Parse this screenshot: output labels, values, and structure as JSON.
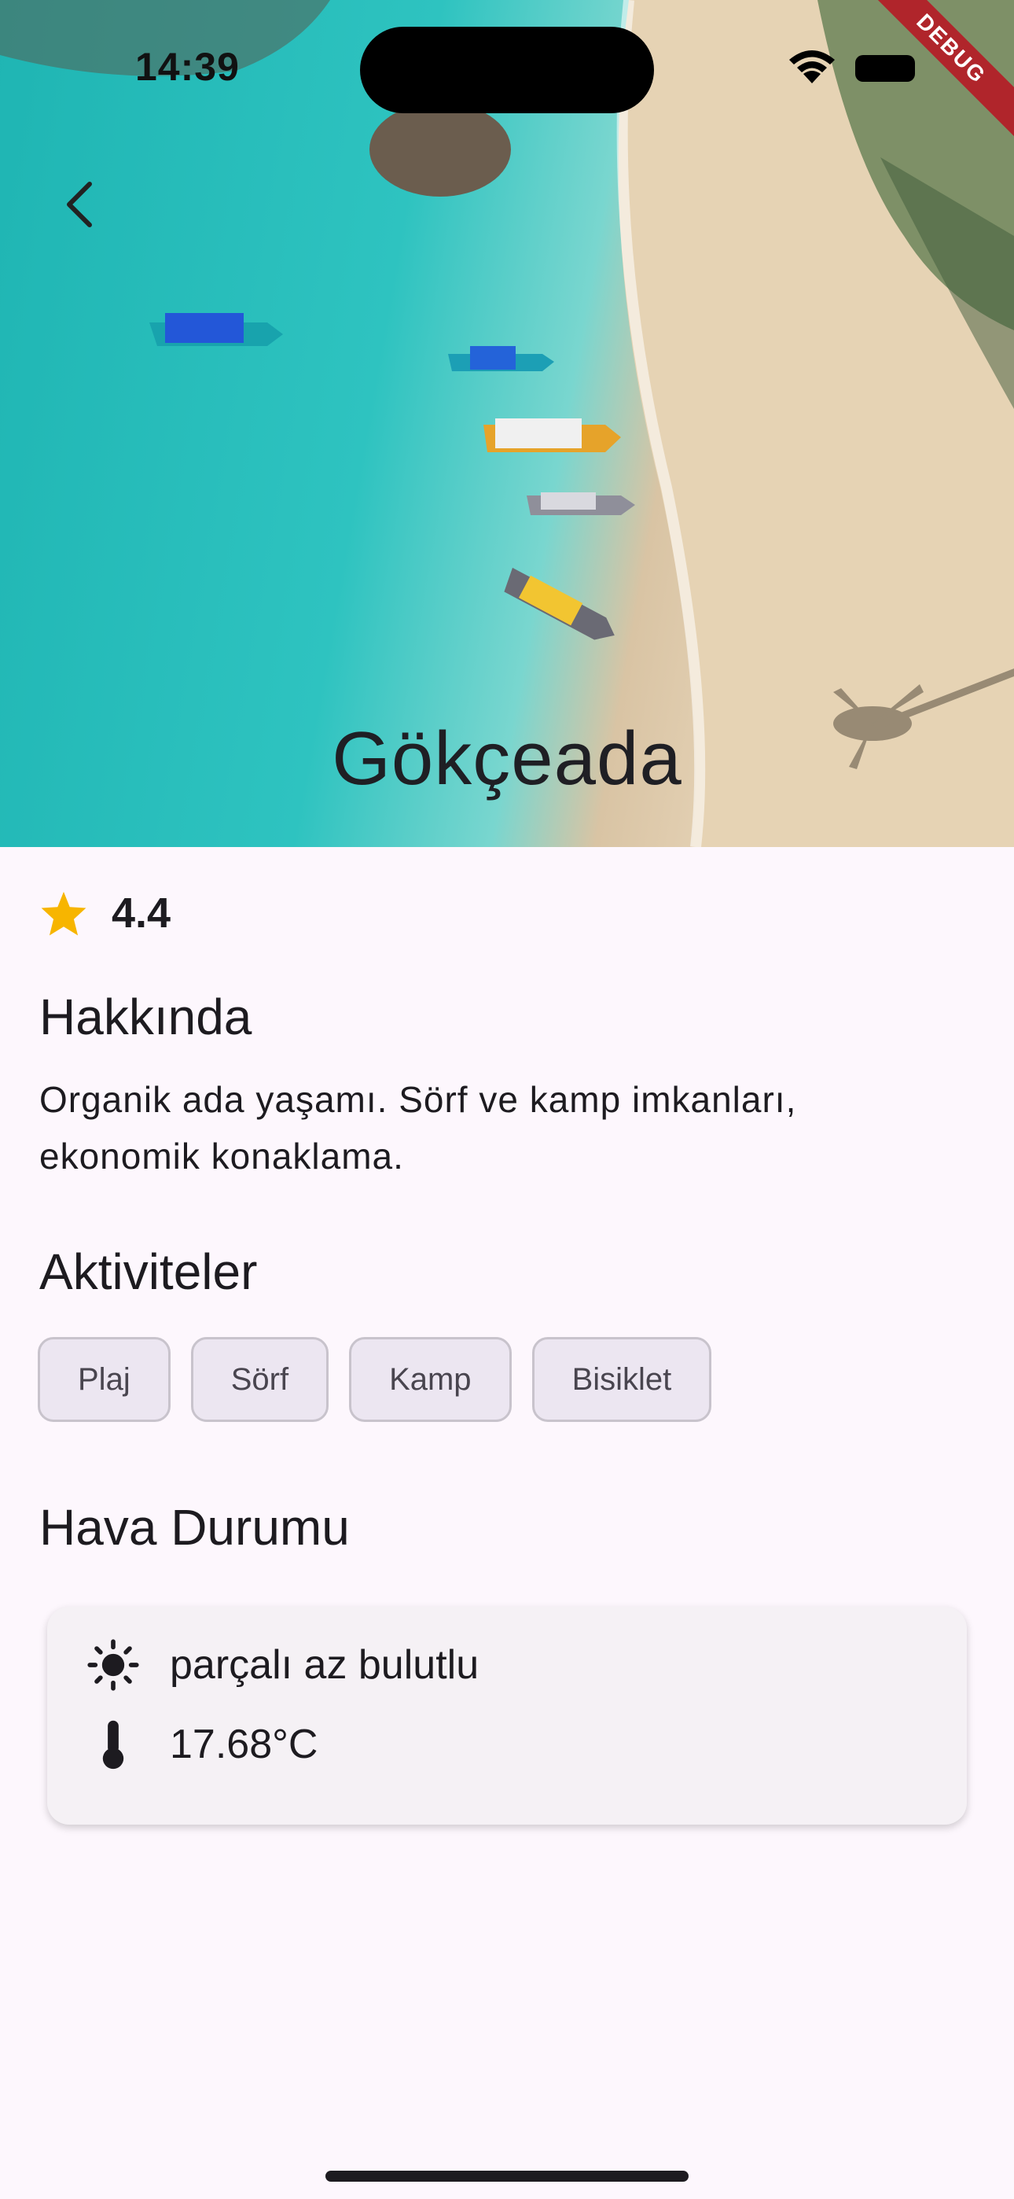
{
  "status_bar": {
    "time": "14:39"
  },
  "debug_banner": "DEBUG",
  "place": {
    "name": "Gökçeada",
    "rating": "4.4"
  },
  "about": {
    "title": "Hakkında",
    "text": "Organik ada yaşamı. Sörf ve kamp imkanları, ekonomik konaklama."
  },
  "activities": {
    "title": "Aktiviteler",
    "items": [
      "Plaj",
      "Sörf",
      "Kamp",
      "Bisiklet"
    ]
  },
  "weather": {
    "title": "Hava Durumu",
    "description": "parçalı az bulutlu",
    "temperature": "17.68°C"
  },
  "colors": {
    "star": "#f7b500",
    "background": "#fdf7fd",
    "chip_bg": "#ece6f1"
  },
  "icons": [
    "back-arrow-icon",
    "star-icon",
    "sun-icon",
    "thermometer-icon"
  ]
}
